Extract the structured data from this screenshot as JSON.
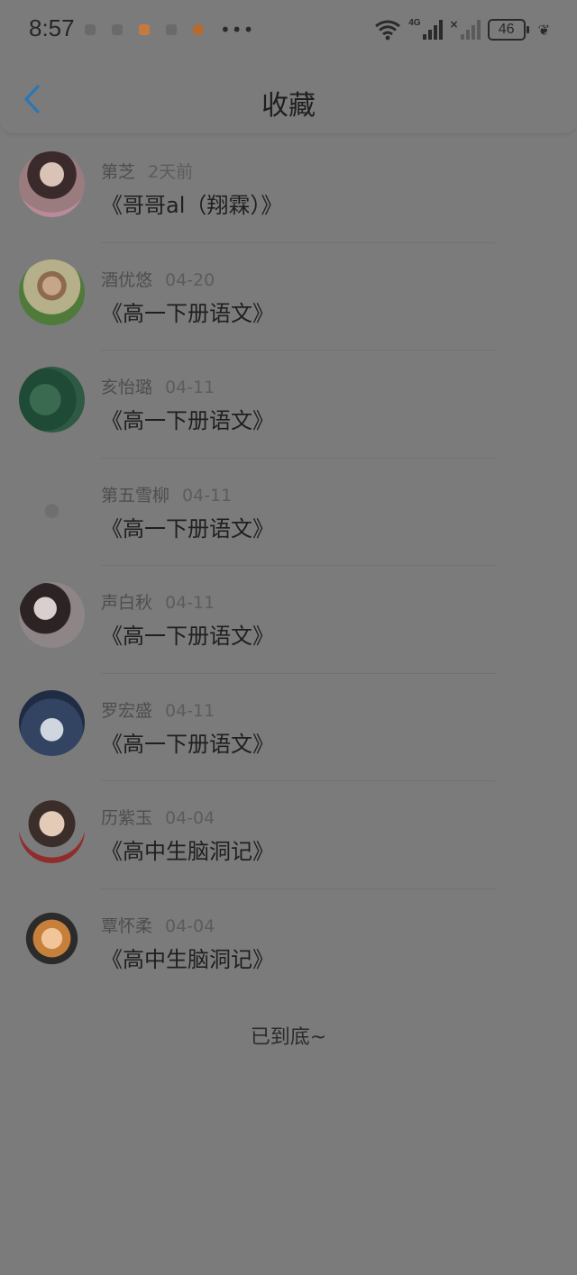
{
  "status_bar": {
    "time": "8:57",
    "overflow_dots": "•••",
    "network_label": "4G",
    "no_signal_mark": "×",
    "battery": "46",
    "notification_icons": [
      "qq-icon",
      "qq-icon",
      "app-icon-orange",
      "cloud-icon",
      "app-icon-brown"
    ]
  },
  "header": {
    "title": "收藏",
    "back_icon": "chevron-left-icon",
    "accent_color": "#2a77b5"
  },
  "favorites": [
    {
      "user": "第芝",
      "date": "2天前",
      "title": "《哥哥al（翔霖）》",
      "avatar": {
        "bg": "radial-gradient(circle at 50% 35%, #d8c3b6 0 22%, #3b2a2b 23% 45%, #9a7b7e 46% 70%, #b98a99 71%)"
      }
    },
    {
      "user": "酒优悠",
      "date": "04-20",
      "title": "《高一下册语文》",
      "avatar": {
        "bg": "radial-gradient(circle at 50% 40%, #c7a58a 0 18%, #8b6a4d 19% 28%, #b6b08a 29% 55%, #4f7a3a 56%)"
      }
    },
    {
      "user": "亥怡璐",
      "date": "04-11",
      "title": "《高一下册语文》",
      "avatar": {
        "bg": "radial-gradient(circle at 40% 50%, #3a6b50 0 30%, #1f4a35 31% 60%, #2e5a44 61%)"
      }
    },
    {
      "user": "第五雪柳",
      "date": "04-11",
      "title": "《高一下册语文》",
      "avatar": {
        "bg": "radial-gradient(circle at 50% 55%, #6f6f6f 0 14%, #7b7b7b 15%)"
      }
    },
    {
      "user": "声白秋",
      "date": "04-11",
      "title": "《高一下册语文》",
      "avatar": {
        "bg": "radial-gradient(circle at 40% 40%, #d9cfcf 0 20%, #2c2424 21% 45%, #8e8686 46% 80%, #7b2a2e 81%)"
      }
    },
    {
      "user": "罗宏盛",
      "date": "04-11",
      "title": "《高一下册语文》",
      "avatar": {
        "bg": "radial-gradient(circle at 50% 60%, #cfd6e0 0 22%, #324462 23% 60%, #1f2c44 61%)"
      }
    },
    {
      "user": "历紫玉",
      "date": "04-04",
      "title": "《高中生脑洞记》",
      "avatar": {
        "bg": "radial-gradient(circle at 50% 40%, #e3cbb7 0 24%, #3a2d2a 25% 45%, #7b7b7b 46% 65%, #8f2d2a 66%)"
      }
    },
    {
      "user": "覃怀柔",
      "date": "04-04",
      "title": "《高中生脑洞记》",
      "avatar": {
        "bg": "radial-gradient(circle at 50% 50%, #f1c49a 0 22%, #c6803c 23% 40%, #2b2b2b 41% 55%, #7b7b7b 56%)"
      }
    }
  ],
  "footer": {
    "end_text": "已到底~"
  }
}
